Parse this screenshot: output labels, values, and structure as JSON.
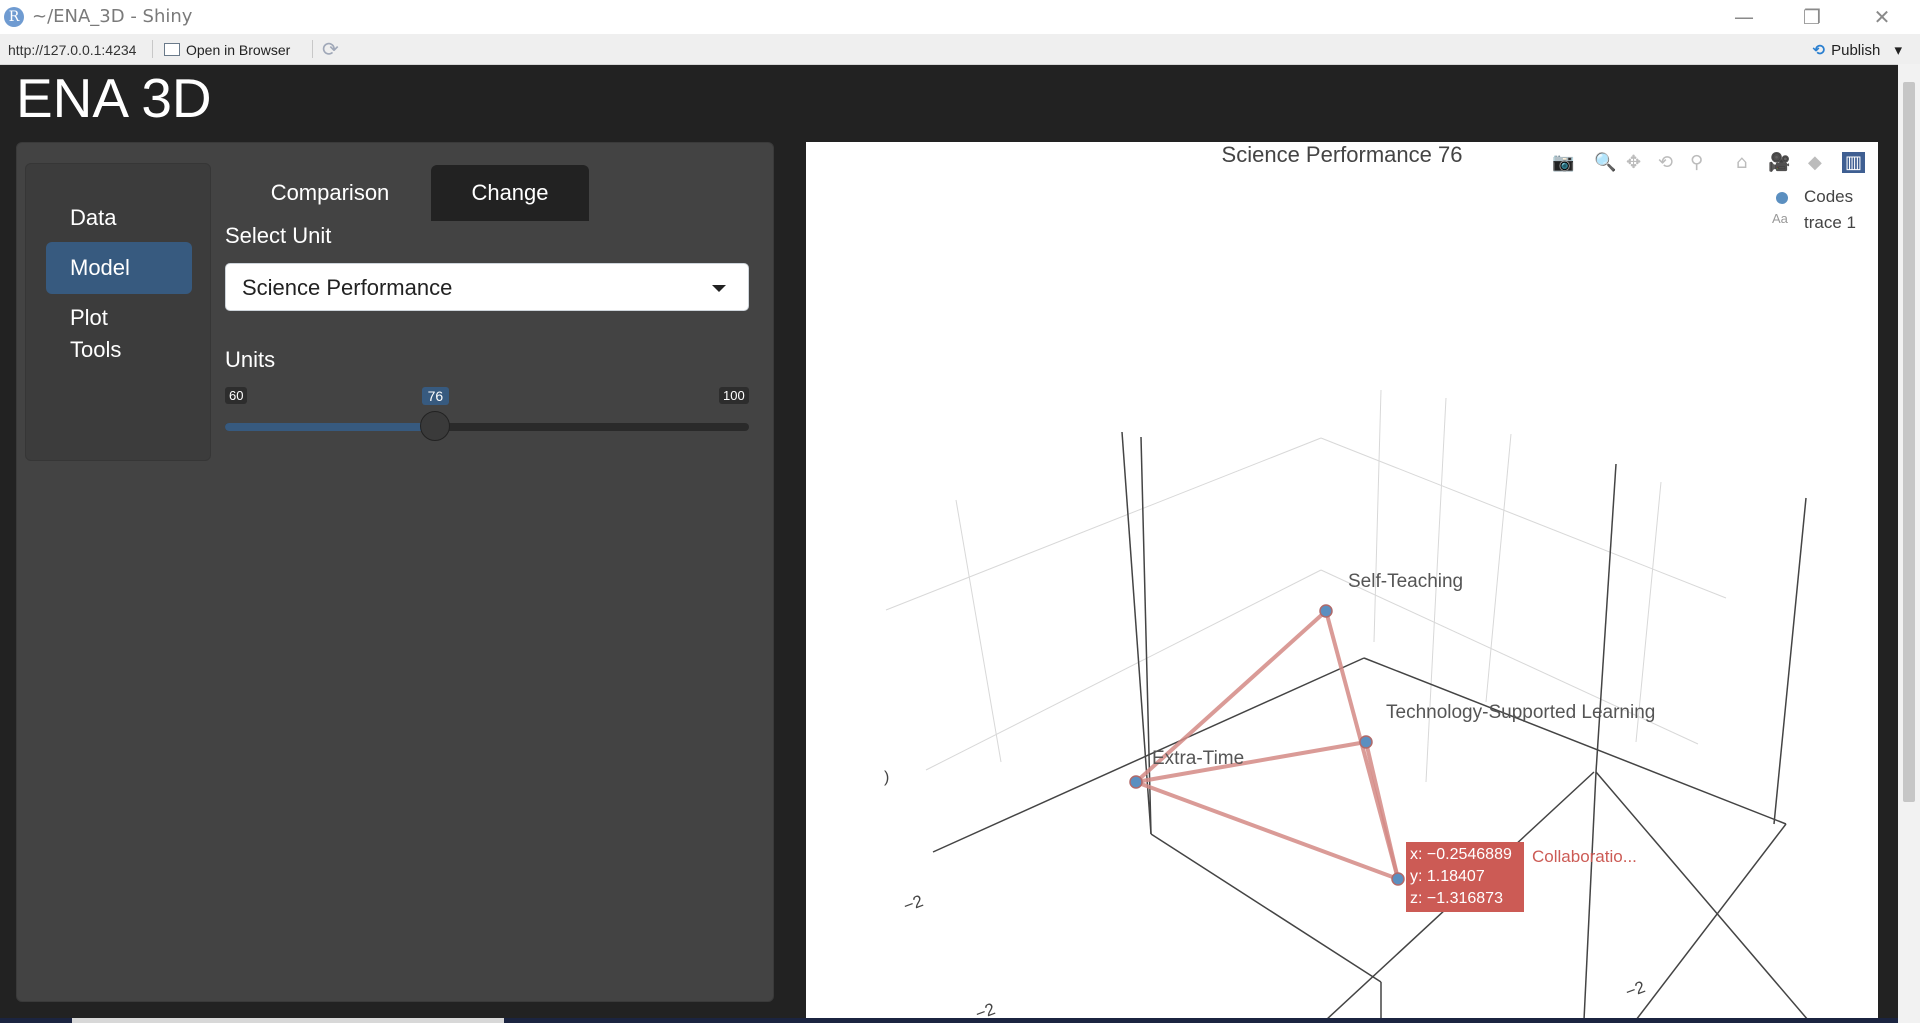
{
  "window": {
    "title": "~/ENA_3D - Shiny",
    "logo_letter": "R",
    "minimize": "—",
    "restore": "❐",
    "close": "✕"
  },
  "addressbar": {
    "url": "http://127.0.0.1:4234",
    "open_in_browser": "Open in Browser",
    "refresh_icon": "⟳",
    "publish_label": "Publish",
    "publish_icon": "⟲",
    "publish_caret": "▾"
  },
  "app": {
    "title": "ENA 3D",
    "nav": [
      {
        "label": "Data"
      },
      {
        "label": "Model"
      },
      {
        "label": "Plot Tools"
      }
    ],
    "active_nav": "Model",
    "tabs": [
      {
        "label": "Comparison"
      },
      {
        "label": "Change"
      }
    ],
    "active_tab": "Change",
    "select_unit": {
      "label": "Select Unit",
      "value": "Science Performance"
    },
    "units": {
      "label": "Units",
      "min": "60",
      "max": "100",
      "value": "76",
      "fraction": 0.4
    }
  },
  "chart_data": {
    "type": "scatter3d",
    "title": "Science Performance 76",
    "legend": {
      "placement": "top-right",
      "entries": [
        "Codes",
        "trace 1"
      ],
      "font_icon": "Aa"
    },
    "modebar_icons": [
      "camera-icon",
      "zoom-icon",
      "pan-icon",
      "orbit-icon",
      "turntable-icon",
      "home-icon",
      "camera-view-icon",
      "tag-icon",
      "plotly-logo-icon"
    ],
    "points": [
      {
        "label": "Self-Teaching"
      },
      {
        "label": "Technology-Supported Learning"
      },
      {
        "label": "Extra-Time"
      },
      {
        "label": "Collaboratio..."
      }
    ],
    "edges": [
      [
        "Self-Teaching",
        "Extra-Time"
      ],
      [
        "Self-Teaching",
        "Collaboratio..."
      ],
      [
        "Extra-Time",
        "Technology-Supported Learning"
      ],
      [
        "Extra-Time",
        "Collaboratio..."
      ],
      [
        "Technology-Supported Learning",
        "Collaboratio..."
      ]
    ],
    "hover": {
      "x": "x: −0.2546889",
      "y": "y: 1.18407",
      "z": "z: −1.316873",
      "name": "Collaboratio..."
    },
    "tick_labels": [
      "−2",
      "−2",
      "−2"
    ],
    "axis_fragment": ")",
    "colors": {
      "points": "#5b8fc0",
      "edges": "#d48a85",
      "hover": "#cc5b55"
    }
  }
}
